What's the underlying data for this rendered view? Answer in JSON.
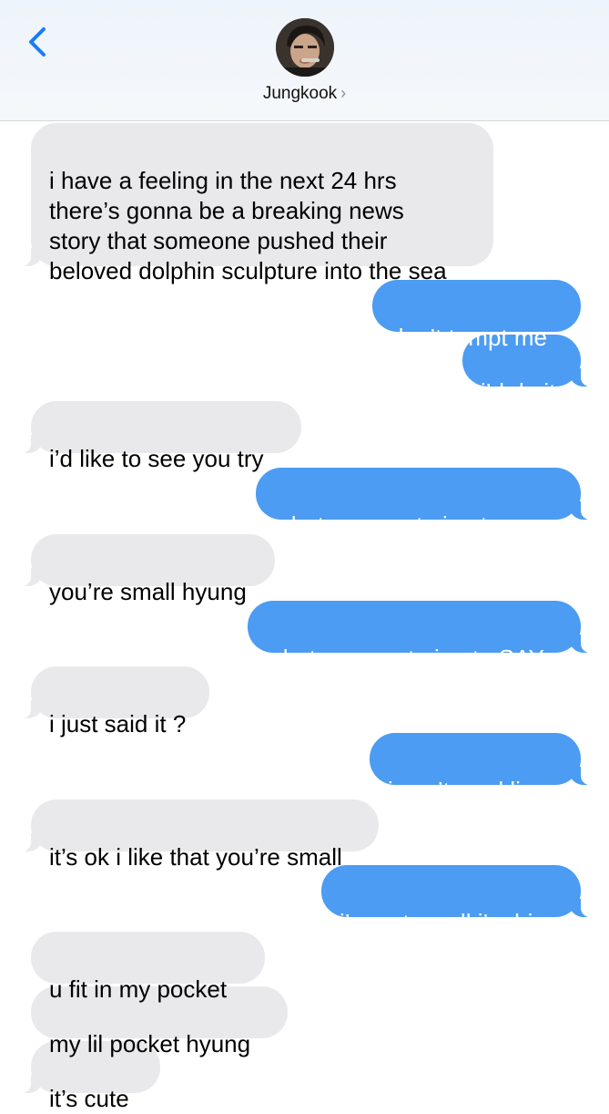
{
  "header": {
    "contact_name": "Jungkook",
    "chevron": "›",
    "back_icon": "chevron-left-icon",
    "accent_color": "#1a7cf5"
  },
  "messages": [
    {
      "sender": "contact",
      "text": "i have a feeling in the next 24 hrs\nthere’s gonna be a breaking news\nstory that someone pushed their\nbeloved dolphin sculpture into the sea"
    },
    {
      "sender": "me",
      "text": "don’t tempt me"
    },
    {
      "sender": "me",
      "text": "i’d do it"
    },
    {
      "sender": "contact",
      "text": "i’d like to see you try"
    },
    {
      "sender": "me",
      "text": "what are you trying to say"
    },
    {
      "sender": "contact",
      "text": "you’re small hyung"
    },
    {
      "sender": "me",
      "text": "what are you trying to SAY"
    },
    {
      "sender": "contact",
      "text": "i just said it ?"
    },
    {
      "sender": "me",
      "text": "i can’t read lies"
    },
    {
      "sender": "contact",
      "text": "it’s ok i like that you’re small"
    },
    {
      "sender": "me",
      "text": "i’m not small i’m big"
    },
    {
      "sender": "contact",
      "text": "u fit in my pocket"
    },
    {
      "sender": "contact",
      "text": "my lil pocket hyung"
    },
    {
      "sender": "contact",
      "text": "it’s cute"
    }
  ],
  "colors": {
    "incoming_bubble": "#e9e9eb",
    "outgoing_bubble": "#4b9cf2"
  }
}
